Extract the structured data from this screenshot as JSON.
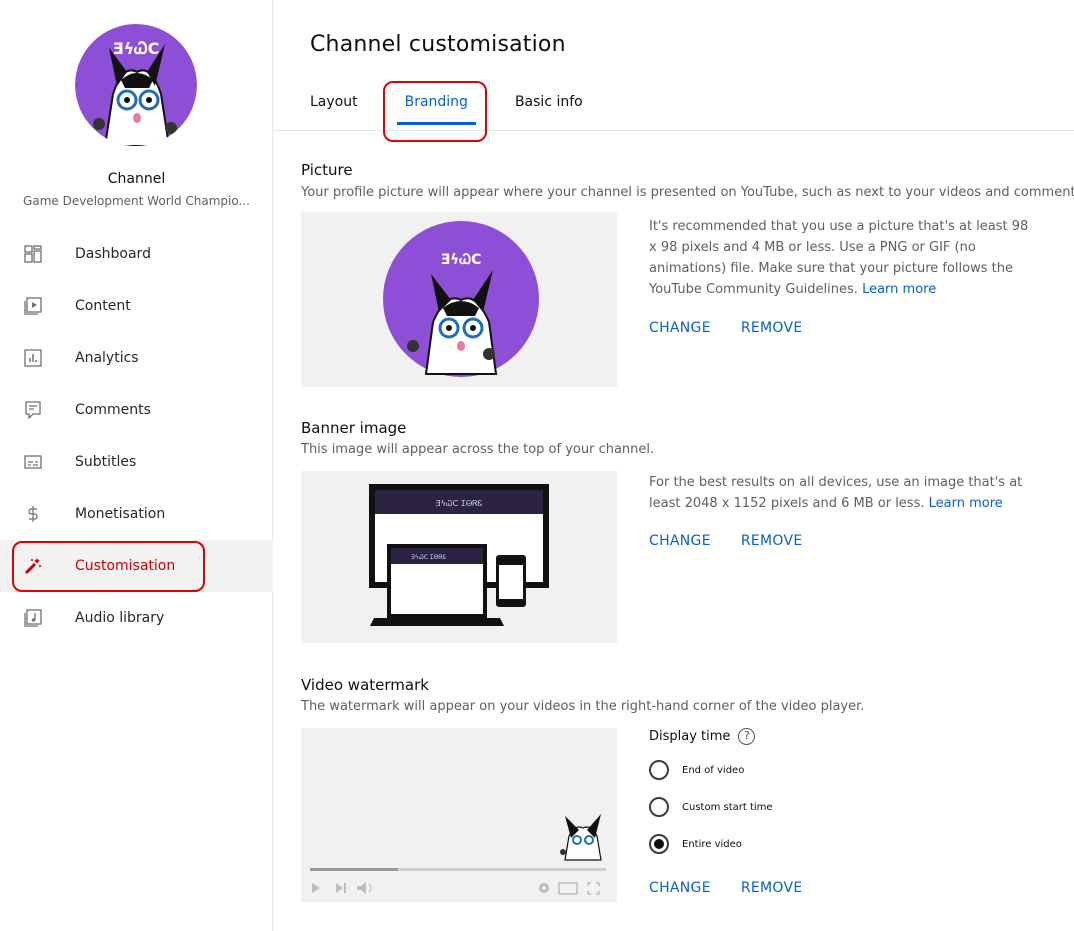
{
  "sidebar": {
    "channel_title": "Channel",
    "channel_subtitle": "Game Development World Champio...",
    "avatar_text": "ƎϟᏇC",
    "items": [
      {
        "label": "Dashboard",
        "icon": "dashboard-icon"
      },
      {
        "label": "Content",
        "icon": "content-icon"
      },
      {
        "label": "Analytics",
        "icon": "analytics-icon"
      },
      {
        "label": "Comments",
        "icon": "comments-icon"
      },
      {
        "label": "Subtitles",
        "icon": "subtitles-icon"
      },
      {
        "label": "Monetisation",
        "icon": "monetisation-icon"
      },
      {
        "label": "Customisation",
        "icon": "magic-wand-icon",
        "active": true
      },
      {
        "label": "Audio library",
        "icon": "audio-library-icon"
      }
    ]
  },
  "main": {
    "title": "Channel customisation",
    "tabs": [
      {
        "label": "Layout"
      },
      {
        "label": "Branding",
        "active": true
      },
      {
        "label": "Basic info"
      }
    ],
    "picture": {
      "title": "Picture",
      "description": "Your profile picture will appear where your channel is presented on YouTube, such as next to your videos and comments",
      "help": "It's recommended that you use a picture that's at least 98 x 98 pixels and 4 MB or less. Use a PNG or GIF (no animations) file. Make sure that your picture follows the YouTube Community Guidelines.",
      "learn_more": "Learn more",
      "change": "CHANGE",
      "remove": "REMOVE"
    },
    "banner": {
      "title": "Banner image",
      "description": "This image will appear across the top of your channel.",
      "help": "For the best results on all devices, use an image that's at least 2048 x 1152 pixels and 6 MB or less.",
      "learn_more": "Learn more",
      "banner_text": "ƎϟᏇC ᏆᎾᏒᏋ",
      "change": "CHANGE",
      "remove": "REMOVE"
    },
    "watermark": {
      "title": "Video watermark",
      "description": "The watermark will appear on your videos in the right-hand corner of the video player.",
      "display_time_label": "Display time",
      "help_glyph": "?",
      "options": [
        {
          "label": "End of video",
          "checked": false
        },
        {
          "label": "Custom start time",
          "checked": false
        },
        {
          "label": "Entire video",
          "checked": true
        }
      ],
      "change": "CHANGE",
      "remove": "REMOVE"
    }
  },
  "colors": {
    "accent_blue": "#065fd4",
    "active_red": "#cc0000",
    "avatar_purple": "#8c4fd6",
    "highlight_red": "#e00000"
  }
}
